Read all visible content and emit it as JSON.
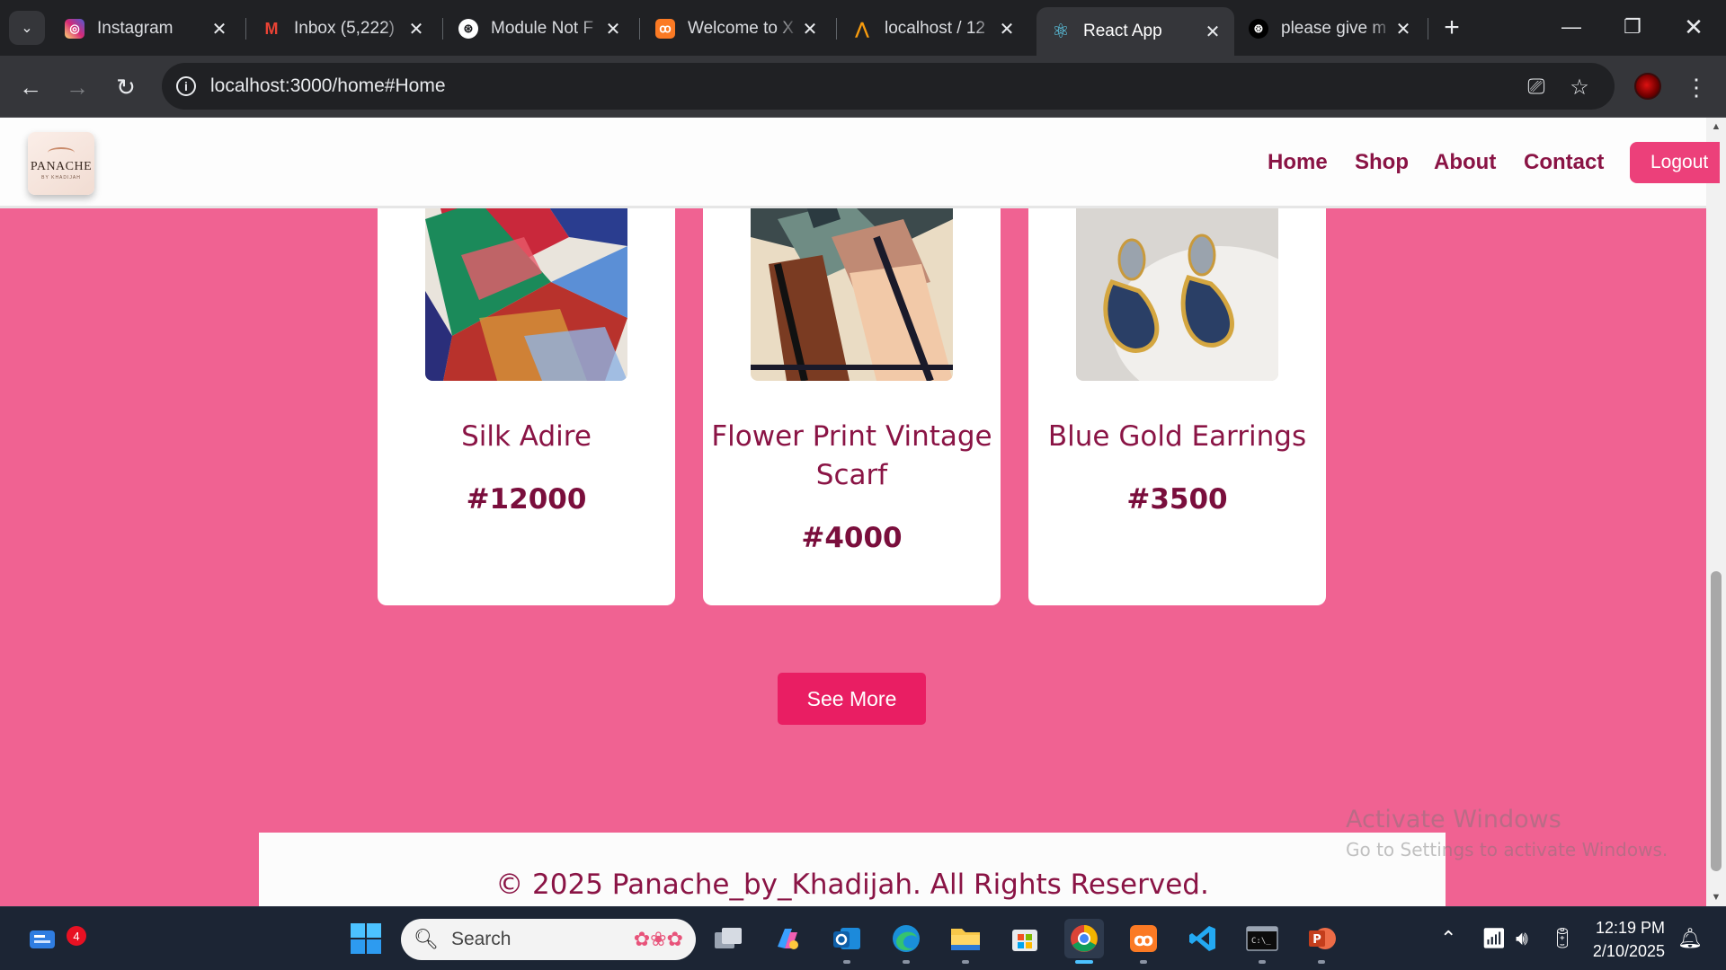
{
  "browser": {
    "tabs": [
      {
        "title": "Instagram",
        "favicon": "instagram-icon",
        "color": "#d62976",
        "glyph": "◎"
      },
      {
        "title": "Inbox (5,222)",
        "favicon": "gmail-icon",
        "color": "#ea4335",
        "glyph": "M"
      },
      {
        "title": "Module Not F",
        "favicon": "chatgpt-icon",
        "color": "#202124",
        "glyph": "⊛"
      },
      {
        "title": "Welcome to X",
        "favicon": "xampp-icon",
        "color": "#fb7a24",
        "glyph": "ꝏ"
      },
      {
        "title": "localhost / 12",
        "favicon": "phpmyadmin-icon",
        "color": "#f89c0e",
        "glyph": "⋀"
      },
      {
        "title": "React App",
        "favicon": "react-icon",
        "color": "#35363a",
        "glyph": "⚛"
      },
      {
        "title": "please give m",
        "favicon": "chatgpt-icon",
        "color": "#202124",
        "glyph": "⊛"
      }
    ],
    "url": "localhost:3000/home#Home"
  },
  "site": {
    "logo_text": "PANACHE",
    "logo_subtext": "BY KHADIJAH",
    "nav": [
      "Home",
      "Shop",
      "About",
      "Contact"
    ],
    "logout_label": "Logout",
    "products": [
      {
        "name": "Silk Adire",
        "price": "#12000"
      },
      {
        "name": "Flower Print Vintage Scarf",
        "price": "#4000"
      },
      {
        "name": "Blue Gold Earrings",
        "price": "#3500"
      }
    ],
    "see_more_label": "See More",
    "footer_text": "© 2025 Panache_by_Khadijah. All Rights Reserved.",
    "accent_color": "#f06292",
    "brand_text_color": "#8a1445"
  },
  "watermark": {
    "line1": "Activate Windows",
    "line2": "Go to Settings to activate Windows."
  },
  "taskbar": {
    "search_placeholder": "Search",
    "notification_count": "4",
    "time": "12:19 PM",
    "date": "2/10/2025"
  }
}
